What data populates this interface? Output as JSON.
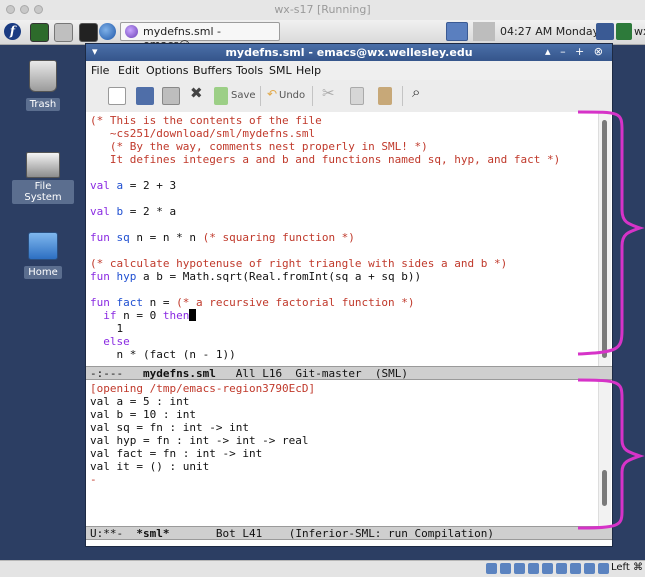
{
  "vm_window": {
    "title": "wx-s17 [Running]"
  },
  "panel": {
    "task_title": "mydefns.sml - emacs@...",
    "clock": "04:27 AM Monday",
    "wx_label": "wx"
  },
  "desktop": {
    "icons": [
      {
        "label": "Trash"
      },
      {
        "label": "File System"
      },
      {
        "label": "Home"
      }
    ]
  },
  "emacs": {
    "title": "mydefns.sml - emacs@wx.wellesley.edu",
    "menu": [
      "File",
      "Edit",
      "Options",
      "Buffers",
      "Tools",
      "SML",
      "Help"
    ],
    "toolbar": {
      "save_label": "Save",
      "undo_label": "Undo"
    },
    "code_lines": [
      "(* This is the contents of the file",
      "   ~cs251/download/sml/mydefns.sml",
      "   (* By the way, comments nest properly in SML! *)",
      "   It defines integers a and b and functions named sq, hyp, and fact *)",
      "",
      "val a = 2 + 3",
      "",
      "val b = 2 * a",
      "",
      "fun sq n = n * n (* squaring function *)",
      "",
      "(* calculate hypotenuse of right triangle with sides a and b *)",
      "fun hyp a b = Math.sqrt(Real.fromInt(sq a + sq b))",
      "",
      "fun fact n = (* a recursive factorial function *)",
      "  if n = 0 then",
      "    1",
      "  else",
      "    n * (fact (n - 1))"
    ],
    "mode_line_top": {
      "status": "-:---",
      "buffer": "mydefns.sml",
      "pos": "All L16",
      "vc": "Git-master",
      "mode": "(SML)"
    },
    "repl_lines": [
      "[opening /tmp/emacs-region3790EcD]",
      "val a = 5 : int",
      "val b = 10 : int",
      "val sq = fn : int -> int",
      "val hyp = fn : int -> int -> real",
      "val fact = fn : int -> int",
      "val it = () : unit",
      "-"
    ],
    "mode_line_bottom": {
      "status": "U:**-",
      "buffer": "*sml*",
      "pos": "Bot L41",
      "mode": "(Inferior-SML: run Compilation)"
    }
  },
  "bottom_bar": {
    "label": "Left ⌘"
  },
  "colors": {
    "annotation": "#d633c8",
    "comment": "#c0392b",
    "keyword": "#8a2be2",
    "function": "#1f4fd1"
  }
}
